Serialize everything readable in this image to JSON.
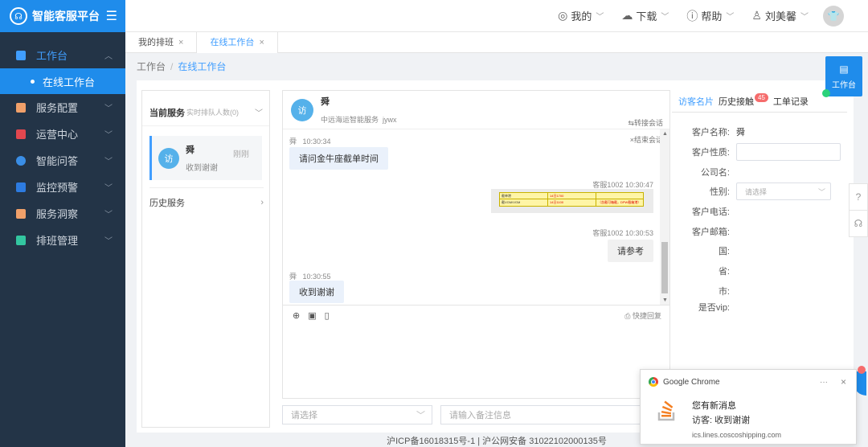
{
  "brand": {
    "title": "智能客服平台"
  },
  "sidebar": {
    "items": [
      {
        "label": "工作台",
        "color": "#409eff"
      },
      {
        "label": "服务配置",
        "color": "#f0a06a"
      },
      {
        "label": "运营中心",
        "color": "#e2474f"
      },
      {
        "label": "智能问答",
        "color": "#3a8ee6"
      },
      {
        "label": "监控预警",
        "color": "#2d7be0"
      },
      {
        "label": "服务洞察",
        "color": "#f0a06a"
      },
      {
        "label": "排班管理",
        "color": "#33c6a0"
      }
    ],
    "active_sub": "在线工作台"
  },
  "topbar": {
    "mine": "我的",
    "download": "下载",
    "help": "帮助",
    "user": "刘美馨"
  },
  "tabs": [
    {
      "label": "我的排班",
      "close": "×"
    },
    {
      "label": "在线工作台",
      "close": "×"
    }
  ],
  "breadcrumb": {
    "root": "工作台",
    "sep": "/",
    "current": "在线工作台"
  },
  "left": {
    "current_service": "当前服务",
    "queue_hint": "实时排队人数(0)",
    "visitor": {
      "avatar": "访",
      "name": "舜",
      "last_msg": "收到谢谢",
      "time": "刚刚"
    },
    "history": "历史服务"
  },
  "chat": {
    "avatar": "访",
    "name": "舜",
    "org": "中远海运智能服务",
    "org_code": "jywx",
    "transfer": "转接会话",
    "end": "结束会话",
    "messages": [
      {
        "who": "舜",
        "time": "10:30:34",
        "text": "请问金牛座截单时间"
      },
      {
        "who": "客服1002",
        "time": "10:30:47",
        "text": ""
      },
      {
        "who": "客服1002",
        "time": "10:30:53",
        "text": "请参考"
      },
      {
        "who": "舜",
        "time": "10:30:55",
        "text": "收到谢谢"
      }
    ],
    "image_table": {
      "r1c1": "截单港",
      "r1c2": "14日1700",
      "r2c1": "截VGM/VGM",
      "r2c2": "14日1100",
      "r2c3": "（含截可箱截，DPW截箱港）"
    },
    "quick_reply": "快捷回复",
    "select_placeholder": "请选择",
    "note_placeholder": "请输入备注信息"
  },
  "right": {
    "tabs": [
      {
        "label": "访客名片"
      },
      {
        "label": "历史接触",
        "badge": "45"
      },
      {
        "label": "工单记录"
      }
    ],
    "fields": [
      {
        "label": "客户名称:",
        "value": "舜"
      },
      {
        "label": "客户性质:",
        "value": ""
      },
      {
        "label": "公司名:",
        "value": ""
      },
      {
        "label": "性别:",
        "placeholder": "请选择"
      },
      {
        "label": "客户电话:",
        "value": ""
      },
      {
        "label": "客户邮箱:",
        "value": ""
      },
      {
        "label": "国:",
        "value": ""
      },
      {
        "label": "省:",
        "value": ""
      },
      {
        "label": "市:",
        "value": ""
      },
      {
        "label": "是否vip:",
        "value": ""
      }
    ]
  },
  "floating": {
    "workbench": "工作台"
  },
  "notification": {
    "app": "Google Chrome",
    "more": "···",
    "close": "×",
    "title": "您有新消息",
    "text": "访客: 收到谢谢",
    "site": "ics.lines.coscoshipping.com"
  },
  "footer": {
    "icp": "沪ICP备16018315号-1 | 沪公网安备 31022102000135号"
  }
}
